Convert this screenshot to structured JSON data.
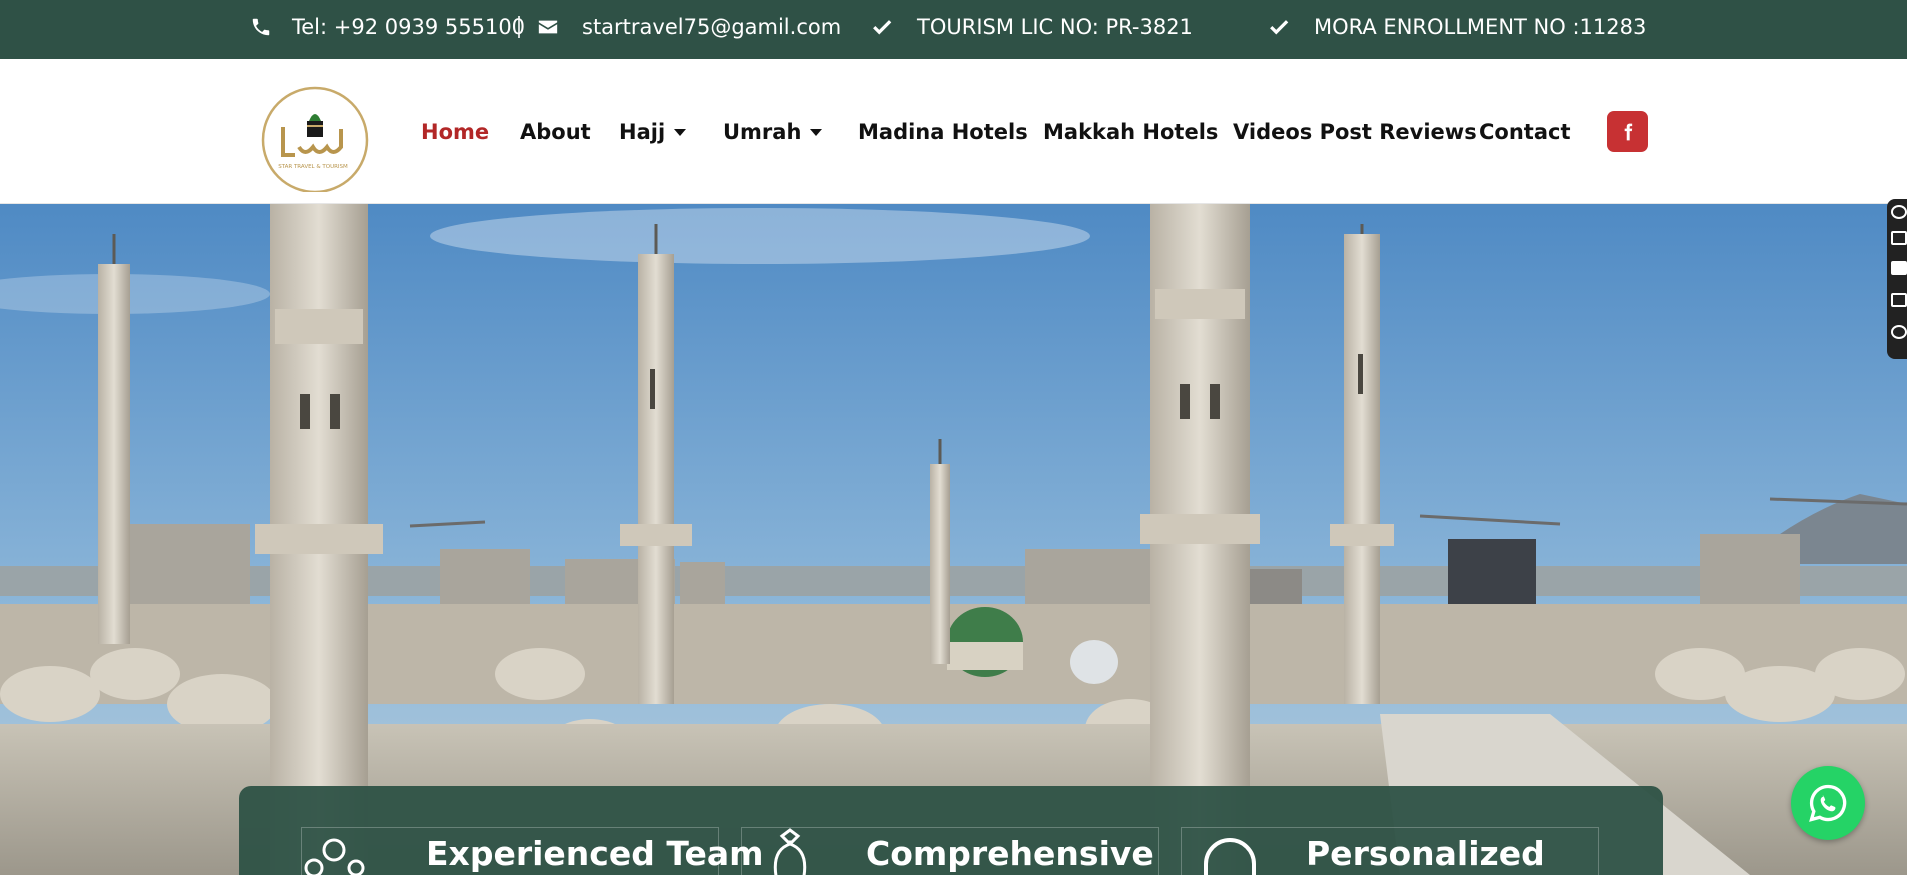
{
  "topbar": {
    "phone": "Tel: +92 0939 555100",
    "email": "startravel75@gamil.com",
    "license": "TOURISM LIC NO: PR-3821",
    "enrollment": "MORA ENROLLMENT NO :11283",
    "icons": [
      "phone-icon",
      "envelope-icon",
      "check-icon",
      "check-icon"
    ]
  },
  "logo": {
    "arabic": "سار",
    "caption": "STAR TRAVEL & TOURISM"
  },
  "nav": {
    "items": [
      {
        "label": "Home",
        "active": true
      },
      {
        "label": "About"
      },
      {
        "label": "Hajj",
        "dropdown": true
      },
      {
        "label": "Umrah",
        "dropdown": true
      },
      {
        "label": "Madina Hotels"
      },
      {
        "label": "Makkah Hotels"
      },
      {
        "label": "Videos Post Reviews"
      },
      {
        "label": "Contact"
      }
    ],
    "social_icon": "facebook-icon"
  },
  "features": [
    {
      "title": "Experienced Team",
      "icon": "team-icon"
    },
    {
      "title": "Comprehensive",
      "icon": "money-bag-icon"
    },
    {
      "title": "Personalized",
      "icon": "headset-icon"
    }
  ],
  "colors": {
    "topbar": "#2f5146",
    "accent": "#b22727",
    "facebook": "#c73133",
    "whatsapp": "#25d366"
  }
}
